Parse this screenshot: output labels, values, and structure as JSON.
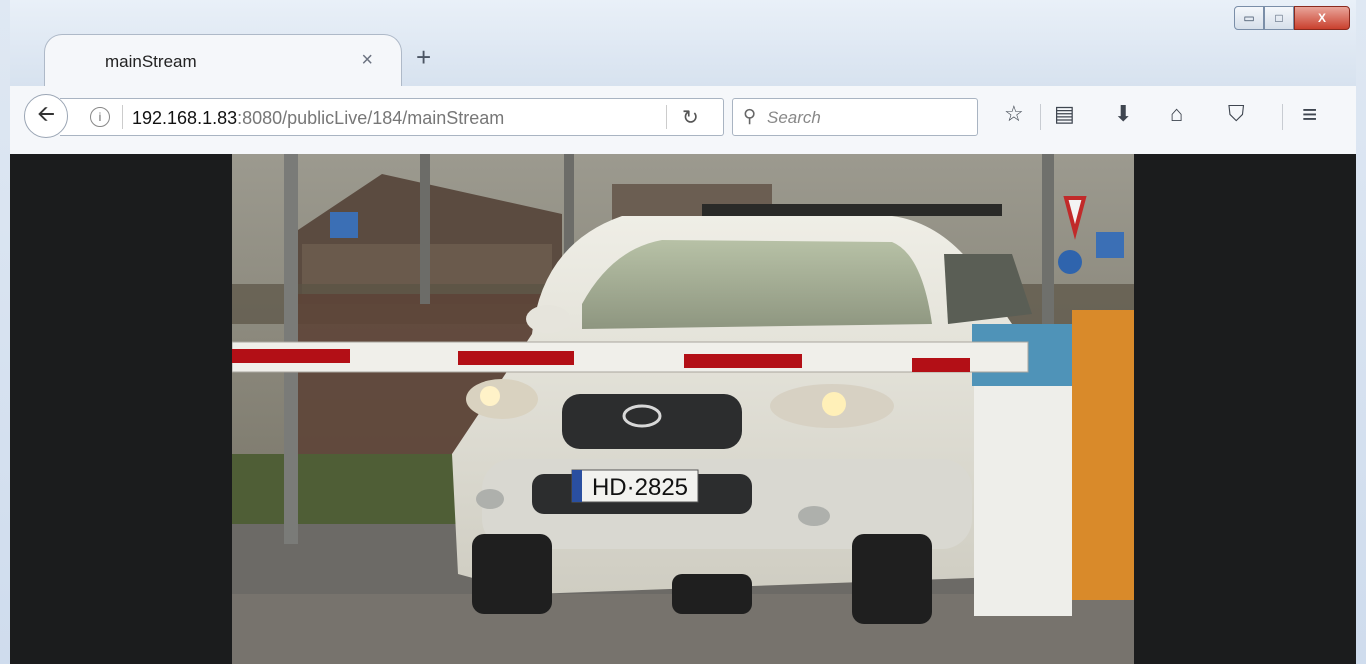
{
  "browser": {
    "tab_title": "mainStream",
    "tab_close": "×",
    "new_tab": "+",
    "url_host": "192.168.1.83",
    "url_rest": ":8080/publicLive/184/mainStream",
    "search_placeholder": "Search",
    "window_buttons": {
      "minimize": "▭",
      "maximize": "□",
      "close": "X"
    }
  },
  "video": {
    "license_plate": "HD·2825"
  },
  "colors": {
    "accent": "#c9402e",
    "barrier_stripe": "#b30f16",
    "page_background": "#1b1c1d"
  }
}
